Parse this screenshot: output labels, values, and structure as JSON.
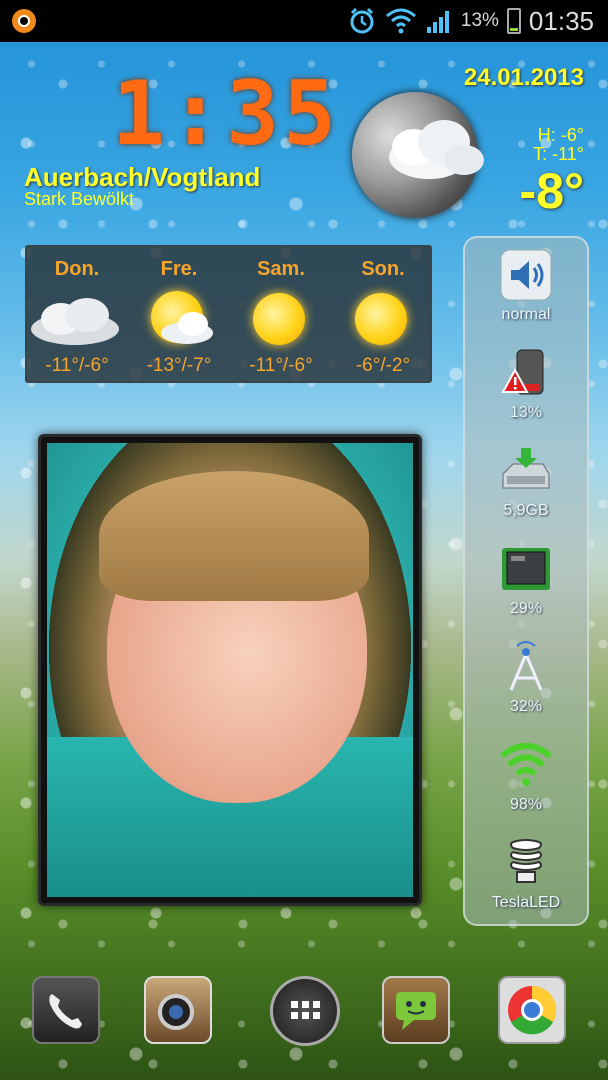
{
  "statusbar": {
    "battery_percent": "13%",
    "time": "01:35",
    "icons": [
      "app-notification-icon",
      "alarm-icon",
      "wifi-icon",
      "signal-icon",
      "battery-icon"
    ]
  },
  "clock_widget": {
    "time": "1:35",
    "date": "24.01.2013",
    "location": "Auerbach/Vogtland",
    "condition": "Stark Bewölkt",
    "high": "H:   -6°",
    "low": "T:  -11°",
    "current_temp": "-8°"
  },
  "forecast": [
    {
      "day": "Don.",
      "temps": "-11°/-6°",
      "icon": "cloud-icon"
    },
    {
      "day": "Fre.",
      "temps": "-13°/-7°",
      "icon": "sun-cloud-icon"
    },
    {
      "day": "Sam.",
      "temps": "-11°/-6°",
      "icon": "sun-icon"
    },
    {
      "day": "Son.",
      "temps": "-6°/-2°",
      "icon": "sun-icon"
    }
  ],
  "status_panel": [
    {
      "name": "volume",
      "label": "normal",
      "icon": "speaker-icon"
    },
    {
      "name": "battery",
      "label": "13%",
      "icon": "battery-warning-icon"
    },
    {
      "name": "storage",
      "label": "5,9GB",
      "icon": "storage-icon"
    },
    {
      "name": "cpu",
      "label": "29%",
      "icon": "cpu-icon"
    },
    {
      "name": "signal",
      "label": "32%",
      "icon": "antenna-icon"
    },
    {
      "name": "wifi",
      "label": "98%",
      "icon": "wifi-icon"
    },
    {
      "name": "flashlight",
      "label": "TeslaLED",
      "icon": "bulb-icon"
    }
  ],
  "dock": [
    {
      "name": "phone",
      "icon": "phone-icon"
    },
    {
      "name": "camera",
      "icon": "camera-icon"
    },
    {
      "name": "app-drawer",
      "icon": "app-drawer-icon"
    },
    {
      "name": "messaging",
      "icon": "messaging-icon"
    },
    {
      "name": "browser",
      "icon": "chrome-icon"
    }
  ]
}
